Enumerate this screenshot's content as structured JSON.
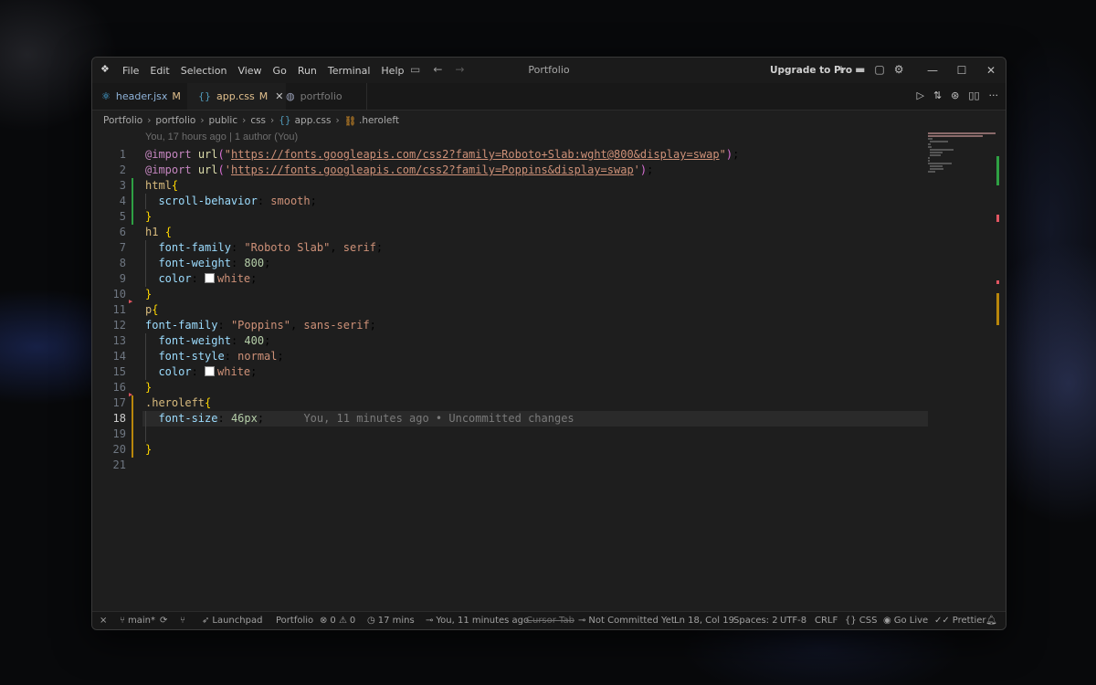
{
  "window": {
    "title": "Portfolio",
    "menu": [
      "File",
      "Edit",
      "Selection",
      "View",
      "Go",
      "Run",
      "Terminal",
      "Help"
    ],
    "upgrade_label": "Upgrade to Pro"
  },
  "tabs": [
    {
      "label": "header.jsx",
      "modified": "M",
      "icon": "react-icon"
    },
    {
      "label": "app.css",
      "modified": "M",
      "icon": "css-braces-icon",
      "active": true
    },
    {
      "label": "portfolio",
      "icon": "globe-icon"
    }
  ],
  "breadcrumb": [
    "Portfolio",
    "portfolio",
    "public",
    "css",
    "app.css",
    ".heroleft"
  ],
  "blame_header": "You, 17 hours ago | 1 author (You)",
  "code_lines": [
    {
      "n": "1",
      "text": "@import url(\"https://fonts.googleapis.com/css2?family=Roboto+Slab:wght@800&display=swap\");"
    },
    {
      "n": "2",
      "text": "@import url('https://fonts.googleapis.com/css2?family=Poppins&display=swap');"
    },
    {
      "n": "3",
      "text": "html{"
    },
    {
      "n": "4",
      "text": "  scroll-behavior: smooth;"
    },
    {
      "n": "5",
      "text": "}"
    },
    {
      "n": "6",
      "text": "h1 {"
    },
    {
      "n": "7",
      "text": "  font-family: \"Roboto Slab\", serif;"
    },
    {
      "n": "8",
      "text": "  font-weight: 800;"
    },
    {
      "n": "9",
      "text": "  color: white;"
    },
    {
      "n": "10",
      "text": "}"
    },
    {
      "n": "11",
      "text": "p{"
    },
    {
      "n": "12",
      "text": "font-family: \"Poppins\", sans-serif;"
    },
    {
      "n": "13",
      "text": "  font-weight: 400;"
    },
    {
      "n": "14",
      "text": "  font-style: normal;"
    },
    {
      "n": "15",
      "text": "  color: white;"
    },
    {
      "n": "16",
      "text": "}"
    },
    {
      "n": "17",
      "text": ".heroleft{"
    },
    {
      "n": "18",
      "text": "  font-size: 46px;"
    },
    {
      "n": "19",
      "text": ""
    },
    {
      "n": "20",
      "text": "}"
    },
    {
      "n": "21",
      "text": ""
    }
  ],
  "inline_blame": "You, 11 minutes ago • Uncommitted changes",
  "status": {
    "branch": "main*",
    "launchpad": "Launchpad",
    "workspace": "Portfolio",
    "errors": "0",
    "warnings": "0",
    "time": "17 mins",
    "blame": "You, 11 minutes ago",
    "cursor_tab": "Cursor Tab",
    "commit": "Not Committed Yet",
    "position": "Ln 18, Col 19",
    "spaces": "Spaces: 2",
    "encoding": "UTF-8",
    "eol": "CRLF",
    "language": "CSS",
    "golive": "Go Live",
    "prettier": "Prettier"
  },
  "colors": {
    "keyword": "#c586c0",
    "string": "#ce9178",
    "property": "#9cdcfe",
    "selector": "#d7ba7d",
    "number": "#b5cea8",
    "bracket": "#ffd700"
  }
}
